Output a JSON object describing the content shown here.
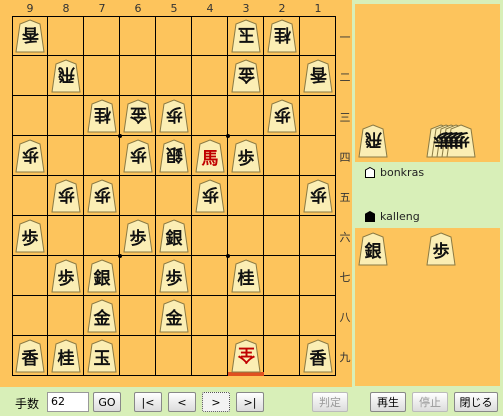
{
  "board": {
    "file_labels": [
      "9",
      "8",
      "7",
      "6",
      "5",
      "4",
      "3",
      "2",
      "1"
    ],
    "rank_labels": [
      "一",
      "二",
      "三",
      "四",
      "五",
      "六",
      "七",
      "八",
      "九"
    ],
    "pieces": [
      {
        "file": 9,
        "rank": 1,
        "char": "香",
        "side": "gote"
      },
      {
        "file": 3,
        "rank": 1,
        "char": "玉",
        "side": "gote"
      },
      {
        "file": 2,
        "rank": 1,
        "char": "桂",
        "side": "gote"
      },
      {
        "file": 8,
        "rank": 2,
        "char": "飛",
        "side": "gote"
      },
      {
        "file": 3,
        "rank": 2,
        "char": "金",
        "side": "gote"
      },
      {
        "file": 1,
        "rank": 2,
        "char": "香",
        "side": "gote"
      },
      {
        "file": 7,
        "rank": 3,
        "char": "桂",
        "side": "gote"
      },
      {
        "file": 6,
        "rank": 3,
        "char": "金",
        "side": "gote"
      },
      {
        "file": 5,
        "rank": 3,
        "char": "歩",
        "side": "gote"
      },
      {
        "file": 2,
        "rank": 3,
        "char": "歩",
        "side": "gote"
      },
      {
        "file": 9,
        "rank": 4,
        "char": "歩",
        "side": "gote"
      },
      {
        "file": 6,
        "rank": 4,
        "char": "歩",
        "side": "gote"
      },
      {
        "file": 5,
        "rank": 4,
        "char": "銀",
        "side": "gote"
      },
      {
        "file": 4,
        "rank": 4,
        "char": "馬",
        "side": "sente",
        "promoted": true
      },
      {
        "file": 3,
        "rank": 4,
        "char": "歩",
        "side": "sente"
      },
      {
        "file": 8,
        "rank": 5,
        "char": "歩",
        "side": "gote"
      },
      {
        "file": 7,
        "rank": 5,
        "char": "歩",
        "side": "gote"
      },
      {
        "file": 4,
        "rank": 5,
        "char": "歩",
        "side": "gote"
      },
      {
        "file": 1,
        "rank": 5,
        "char": "歩",
        "side": "gote"
      },
      {
        "file": 9,
        "rank": 6,
        "char": "歩",
        "side": "sente"
      },
      {
        "file": 6,
        "rank": 6,
        "char": "歩",
        "side": "sente"
      },
      {
        "file": 5,
        "rank": 6,
        "char": "銀",
        "side": "sente"
      },
      {
        "file": 8,
        "rank": 7,
        "char": "歩",
        "side": "sente"
      },
      {
        "file": 7,
        "rank": 7,
        "char": "銀",
        "side": "sente"
      },
      {
        "file": 5,
        "rank": 7,
        "char": "歩",
        "side": "sente"
      },
      {
        "file": 3,
        "rank": 7,
        "char": "桂",
        "side": "sente"
      },
      {
        "file": 7,
        "rank": 8,
        "char": "金",
        "side": "sente"
      },
      {
        "file": 5,
        "rank": 8,
        "char": "金",
        "side": "sente"
      },
      {
        "file": 9,
        "rank": 9,
        "char": "香",
        "side": "sente"
      },
      {
        "file": 8,
        "rank": 9,
        "char": "桂",
        "side": "sente"
      },
      {
        "file": 7,
        "rank": 9,
        "char": "玉",
        "side": "sente"
      },
      {
        "file": 3,
        "rank": 9,
        "char": "全",
        "side": "gote",
        "promoted": true
      },
      {
        "file": 1,
        "rank": 9,
        "char": "香",
        "side": "sente"
      }
    ],
    "last_move_square": {
      "file": 3,
      "rank": 9
    }
  },
  "gote_hand": {
    "player_name": "bonkras",
    "pieces": [
      {
        "char": "飛",
        "count": 1
      },
      {
        "char": "歩",
        "count": 5
      }
    ]
  },
  "sente_hand": {
    "player_name": "kalleng",
    "pieces": [
      {
        "char": "銀",
        "count": 1
      },
      {
        "char": "歩",
        "count": 1
      }
    ]
  },
  "controls": {
    "move_label": "手数",
    "move_number": "62",
    "go_label": "GO",
    "first_label": "|<",
    "prev_label": "<",
    "next_label": ">",
    "last_label": ">|",
    "judge_label": "判定",
    "play_label": "再生",
    "stop_label": "停止",
    "close_label": "閉じる"
  }
}
